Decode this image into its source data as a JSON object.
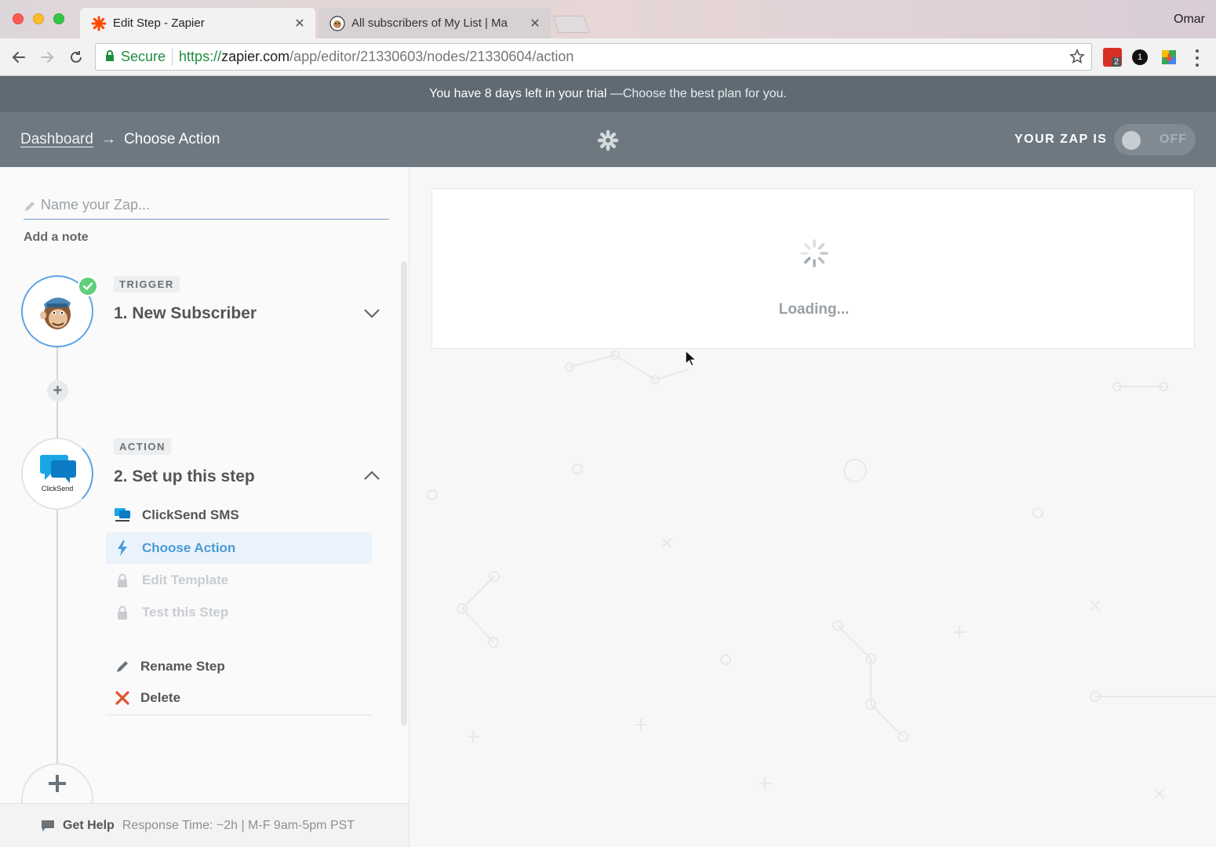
{
  "browser": {
    "profile_name": "Omar",
    "tabs": [
      {
        "title": "Edit Step - Zapier",
        "active": true,
        "icon": "zapier-asterisk-icon"
      },
      {
        "title": "All subscribers of My List | Ma",
        "active": false,
        "icon": "mailchimp-icon"
      }
    ],
    "omnibox": {
      "secure_label": "Secure",
      "url_scheme": "https://",
      "url_host": "zapier.com",
      "url_path": "/app/editor/21330603/nodes/21330604/action"
    },
    "extensions": {
      "gmail_badge": "2",
      "onepassword_badge": "1"
    }
  },
  "trial_banner": {
    "text": "You have 8 days left in your trial —",
    "cta": "Choose the best plan for you."
  },
  "header": {
    "breadcrumb_root": "Dashboard",
    "breadcrumb_arrow": "→",
    "breadcrumb_current": "Choose Action",
    "zap_status_label": "YOUR ZAP IS",
    "toggle_state": "OFF"
  },
  "editor": {
    "name_placeholder": "Name your Zap...",
    "add_note": "Add a note",
    "steps": [
      {
        "tag": "TRIGGER",
        "title": "1. New Subscriber",
        "app": "MailChimp",
        "complete": true
      },
      {
        "tag": "ACTION",
        "title": "2. Set up this step",
        "app": "ClickSend",
        "app_logo_text": "ClickSend"
      }
    ],
    "substeps": {
      "app": "ClickSend SMS",
      "choose_action": "Choose Action",
      "edit_template": "Edit Template",
      "test_step": "Test this Step",
      "rename": "Rename Step",
      "delete": "Delete"
    },
    "help": {
      "label": "Get Help",
      "response_time": "Response Time: ~2h | M-F 9am-5pm PST"
    }
  },
  "main": {
    "loading_text": "Loading..."
  },
  "colors": {
    "accent_blue": "#4a9bd8",
    "success_green": "#5fcf79",
    "delete_red": "#e0532d",
    "header_bg": "#6d7880"
  }
}
